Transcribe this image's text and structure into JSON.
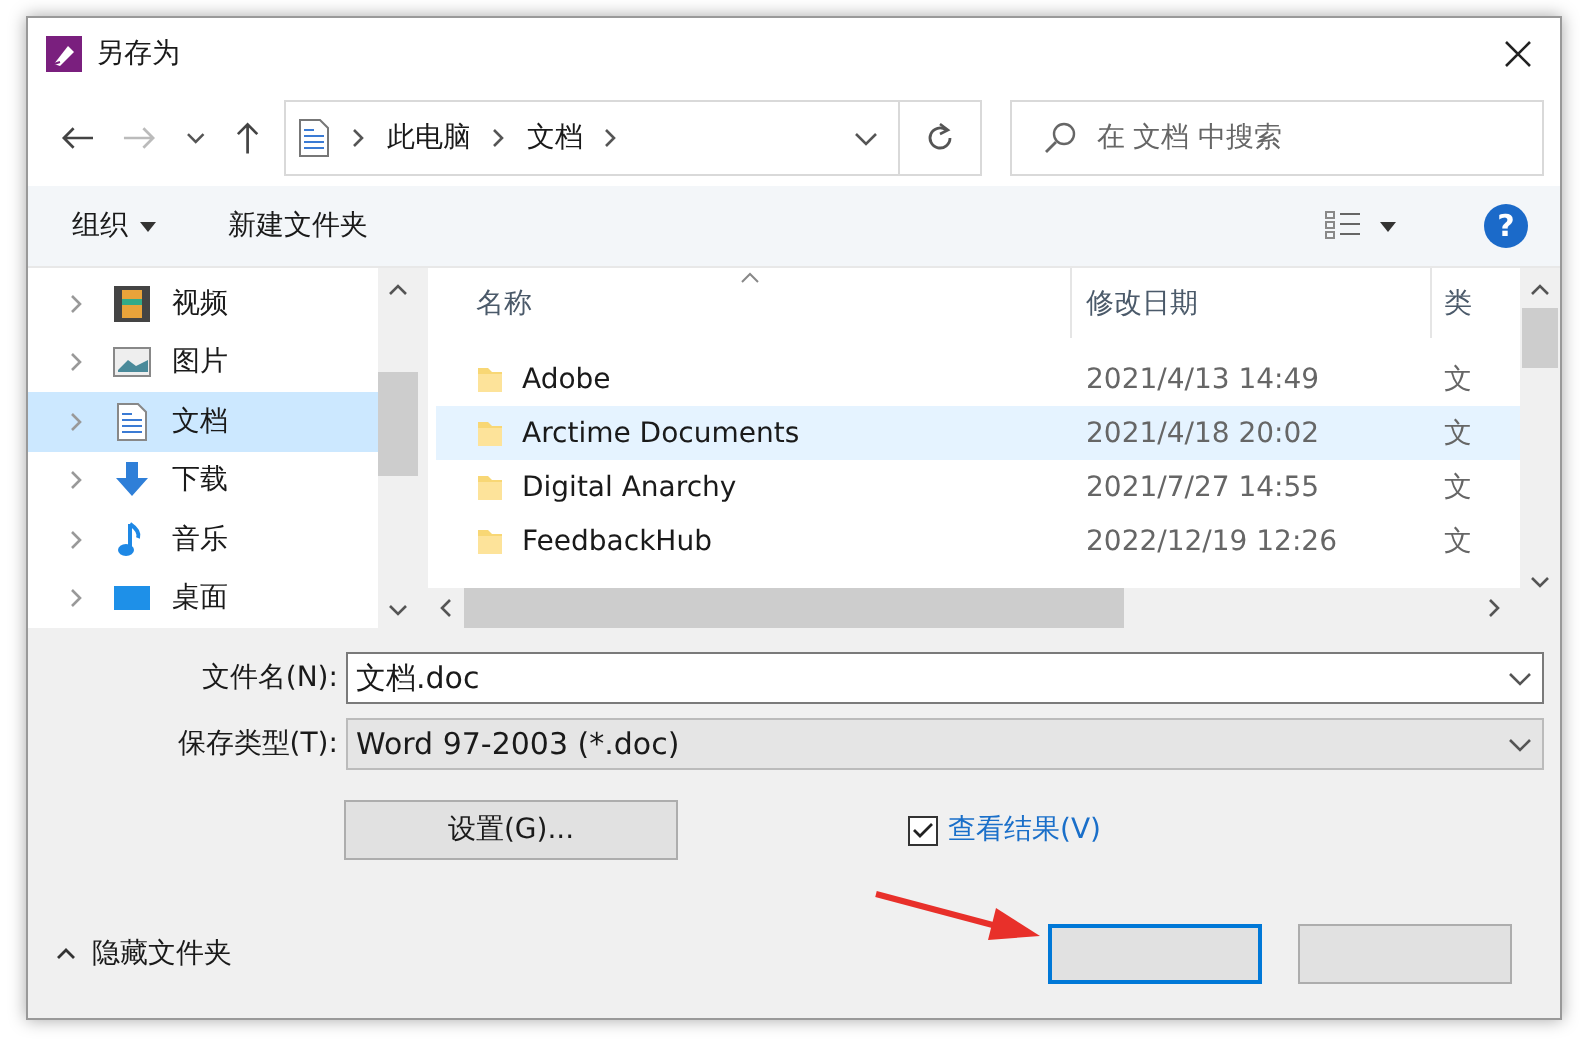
{
  "window": {
    "title": "另存为"
  },
  "address_bar": {
    "segments": [
      "此电脑",
      "文档"
    ]
  },
  "search": {
    "placeholder": "在 文档 中搜索"
  },
  "toolbar": {
    "organize": "组织",
    "new_folder": "新建文件夹",
    "help": "?"
  },
  "sidebar": {
    "items": [
      {
        "label": "视频",
        "kind": "video",
        "selected": false
      },
      {
        "label": "图片",
        "kind": "picture",
        "selected": false
      },
      {
        "label": "文档",
        "kind": "document",
        "selected": true
      },
      {
        "label": "下载",
        "kind": "download",
        "selected": false
      },
      {
        "label": "音乐",
        "kind": "music",
        "selected": false
      },
      {
        "label": "桌面",
        "kind": "desktop",
        "selected": false
      }
    ]
  },
  "file_list": {
    "columns": [
      "名称",
      "修改日期",
      "类"
    ],
    "rows": [
      {
        "name": "Adobe",
        "modified": "2021/4/13 14:49",
        "type": "文",
        "highlighted": false
      },
      {
        "name": "Arctime Documents",
        "modified": "2021/4/18 20:02",
        "type": "文",
        "highlighted": true
      },
      {
        "name": "Digital Anarchy",
        "modified": "2021/7/27 14:55",
        "type": "文",
        "highlighted": false
      },
      {
        "name": "FeedbackHub",
        "modified": "2022/12/19 12:26",
        "type": "文",
        "highlighted": false
      }
    ]
  },
  "file_name": {
    "label": "文件名(N):",
    "value": "文档.doc"
  },
  "save_type": {
    "label": "保存类型(T):",
    "value": "Word 97-2003 (*.doc)"
  },
  "settings_button": "设置(G)...",
  "view_results": {
    "label": "查看结果(V)",
    "checked": true
  },
  "hide_folders": "隐藏文件夹"
}
